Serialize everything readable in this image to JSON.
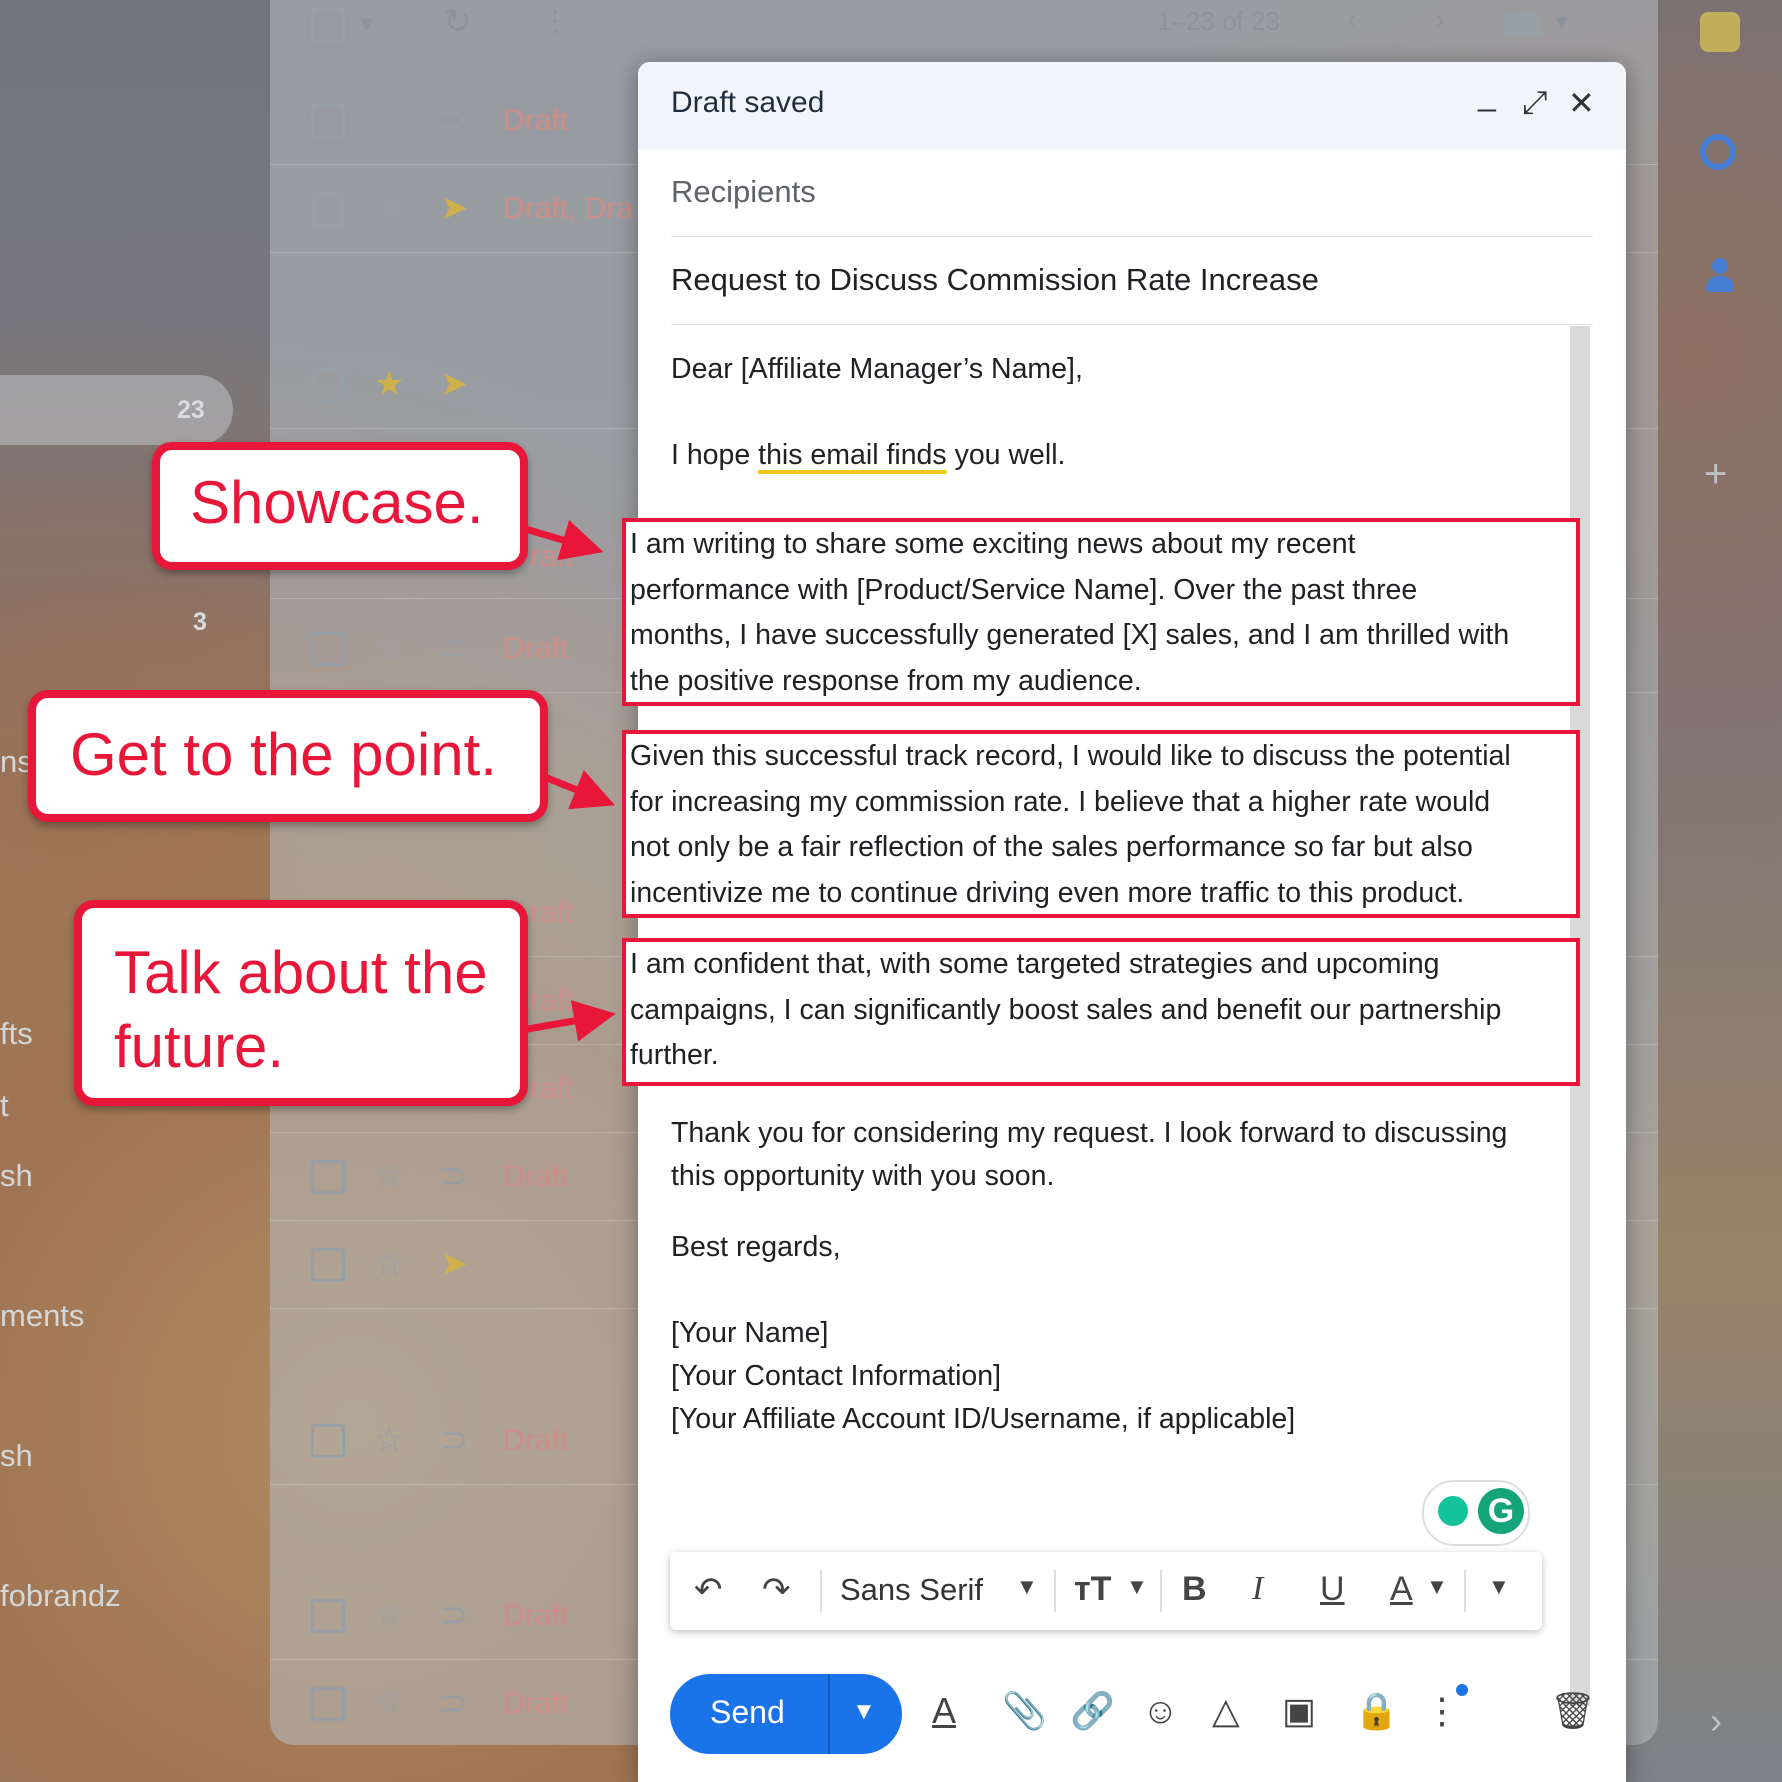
{
  "inbox": {
    "pagination": "1–23 of 23",
    "draft_label": "Draft",
    "draft_pair_label": "Draft, Dra",
    "partial_draft": "raft",
    "sidebar_count_primary": "23",
    "sidebar_count_secondary": "3",
    "sidebar_fragments": [
      "ns",
      "fts",
      "t",
      "sh",
      "ments",
      "sh",
      "fobrandz"
    ]
  },
  "compose": {
    "title": "Draft saved",
    "recipients_placeholder": "Recipients",
    "subject": "Request to Discuss Commission Rate Increase",
    "greeting": "Dear [Affiliate Manager’s Name],",
    "opening_pre": "I hope ",
    "opening_hl": "this email finds",
    "opening_post": " you well.",
    "para1_lines": [
      "I am writing to share some exciting news about my recent",
      "performance with [Product/Service Name]. Over the past three",
      "months, I have successfully generated [X] sales, and I am thrilled with",
      "the positive response from my audience."
    ],
    "para2_lines": [
      "Given this successful track record, I would like to discuss the potential",
      "for increasing my commission rate. I believe that a higher rate would",
      "not only be a fair reflection of the sales performance so far but also",
      "incentivize me to continue driving even more traffic to this product."
    ],
    "para3_lines": [
      "I am confident that, with some targeted strategies and upcoming",
      "campaigns, I can significantly boost sales and benefit our partnership",
      "further."
    ],
    "closing_line1": "Thank you for considering my request. I look forward to discussing",
    "closing_line2": "this opportunity with you soon.",
    "signoff": "Best regards,",
    "signature": [
      "[Your Name]",
      "[Your Contact Information]",
      "[Your Affiliate Account ID/Username, if applicable]"
    ],
    "font_select": "Sans Serif",
    "send_label": "Send"
  },
  "callouts": {
    "showcase": "Showcase.",
    "point": "Get to the point.",
    "future_line1": "Talk about the",
    "future_line2": "future."
  },
  "colors": {
    "accent_red": "#e8173a",
    "send_blue": "#1a73e8",
    "highlight_yellow": "#f5c518"
  }
}
